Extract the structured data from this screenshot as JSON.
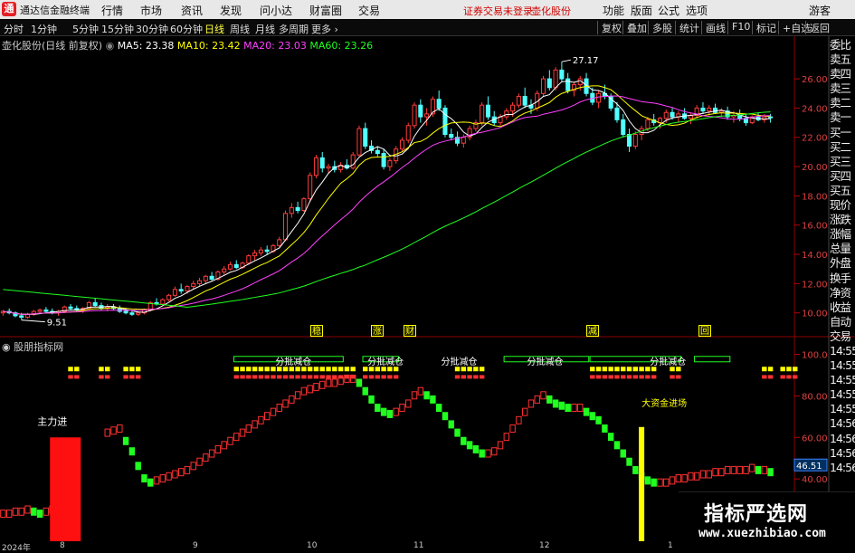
{
  "titlebar": {
    "app_name": "通达信金融终端",
    "menu": [
      "行情",
      "市场",
      "资讯",
      "发现",
      "问小达",
      "财富圈",
      "交易"
    ],
    "warning": "证券交易未登录",
    "stock": "壶化股份",
    "right_menu": [
      "功能",
      "版面",
      "公式",
      "选项"
    ],
    "guest": "游客"
  },
  "toolbar": {
    "periods": [
      "分时",
      "1分钟",
      "5分钟",
      "15分钟",
      "30分钟",
      "60分钟",
      "日线",
      "周线",
      "月线",
      "多周期",
      "更多 ›"
    ],
    "active_period": "日线",
    "right_buttons": [
      "复权",
      "叠加",
      "多股",
      "统计",
      "画线",
      "F10",
      "标记",
      "+自选",
      "返回"
    ]
  },
  "legend": {
    "name": "壶化股份(日线 前复权)",
    "ma5_label": "MA5: 23.38",
    "ma10_label": "MA10: 23.42",
    "ma20_label": "MA20: 23.03",
    "ma60_label": "MA60: 23.26"
  },
  "colors": {
    "ma5": "#ffffff",
    "ma10": "#ffff00",
    "ma20": "#ff40ff",
    "ma60": "#20ff20",
    "up": "#ff3c3c",
    "down": "#50ffff"
  },
  "price_axis": [
    "26.00",
    "24.00",
    "22.00",
    "20.00",
    "18.00",
    "16.00",
    "14.00",
    "12.00",
    "10.00"
  ],
  "indicator": {
    "title": "股朋指标网",
    "axis": [
      "100.0",
      "80.00",
      "60.00",
      "40.00"
    ],
    "current_value": "46.51",
    "label_main": "主力进",
    "label_big": "大资金进场",
    "label_reduce": "分批减仓"
  },
  "annotations": {
    "high": "27.17",
    "low": "9.51"
  },
  "price_tags": [
    "稳",
    "涨",
    "财",
    "减",
    "回"
  ],
  "side_panel": [
    "委比",
    "卖五",
    "卖四",
    "卖三",
    "卖二",
    "卖一",
    "买一",
    "买二",
    "买三",
    "买四",
    "买五",
    "现价",
    "涨跌",
    "涨幅",
    "总量",
    "外盘",
    "换手",
    "净资",
    "收益",
    "自动",
    "交易",
    "14:55",
    "14:55",
    "14:55",
    "14:55",
    "14:55",
    "14:56",
    "14:56",
    "14:56",
    "14:56"
  ],
  "time_axis": [
    "2024年",
    "8",
    "9",
    "10",
    "11",
    "12",
    "1"
  ],
  "watermark": {
    "brand": "指标严选网",
    "url": "www.xuezhibiao.com"
  },
  "chart_data": {
    "type": "candlestick",
    "y_range": [
      9.3,
      27.8
    ],
    "x_count": 126,
    "ohlc": [
      [
        10.0,
        10.2,
        9.8,
        10.1
      ],
      [
        10.1,
        10.3,
        9.9,
        10.0
      ],
      [
        10.0,
        10.1,
        9.7,
        9.8
      ],
      [
        9.8,
        10.0,
        9.51,
        9.7
      ],
      [
        9.7,
        10.0,
        9.6,
        9.9
      ],
      [
        9.9,
        10.2,
        9.8,
        10.1
      ],
      [
        10.1,
        10.3,
        10.0,
        10.2
      ],
      [
        10.2,
        10.4,
        10.0,
        10.1
      ],
      [
        10.1,
        10.3,
        9.9,
        10.0
      ],
      [
        10.0,
        10.2,
        9.8,
        10.1
      ],
      [
        10.1,
        10.5,
        10.0,
        10.4
      ],
      [
        10.4,
        10.6,
        10.2,
        10.3
      ],
      [
        10.3,
        10.5,
        10.1,
        10.2
      ],
      [
        10.2,
        10.4,
        10.0,
        10.3
      ],
      [
        10.3,
        10.8,
        10.2,
        10.7
      ],
      [
        10.7,
        11.0,
        10.4,
        10.5
      ],
      [
        10.5,
        10.7,
        10.2,
        10.3
      ],
      [
        10.3,
        10.6,
        10.1,
        10.4
      ],
      [
        10.4,
        10.6,
        10.2,
        10.3
      ],
      [
        10.3,
        10.5,
        10.0,
        10.1
      ],
      [
        10.1,
        10.3,
        9.9,
        10.0
      ],
      [
        10.0,
        10.2,
        9.8,
        9.9
      ],
      [
        9.9,
        10.1,
        9.8,
        10.0
      ],
      [
        10.0,
        10.3,
        9.9,
        10.2
      ],
      [
        10.2,
        10.8,
        10.1,
        10.7
      ],
      [
        10.7,
        11.0,
        10.5,
        10.6
      ],
      [
        10.6,
        11.0,
        10.5,
        10.9
      ],
      [
        10.9,
        11.3,
        10.8,
        11.2
      ],
      [
        11.2,
        11.8,
        11.1,
        11.6
      ],
      [
        11.6,
        12.0,
        11.3,
        11.5
      ],
      [
        11.5,
        11.9,
        11.3,
        11.8
      ],
      [
        11.8,
        12.2,
        11.6,
        12.0
      ],
      [
        12.0,
        12.4,
        11.8,
        12.2
      ],
      [
        12.2,
        12.6,
        12.0,
        12.5
      ],
      [
        12.5,
        12.8,
        12.2,
        12.3
      ],
      [
        12.3,
        12.9,
        12.2,
        12.8
      ],
      [
        12.8,
        13.2,
        12.6,
        13.0
      ],
      [
        13.0,
        13.5,
        12.9,
        13.3
      ],
      [
        13.3,
        13.6,
        13.0,
        13.1
      ],
      [
        13.1,
        13.5,
        13.0,
        13.4
      ],
      [
        13.4,
        14.0,
        13.3,
        13.9
      ],
      [
        13.9,
        14.3,
        13.6,
        14.1
      ],
      [
        14.1,
        14.5,
        13.9,
        14.3
      ],
      [
        14.3,
        14.6,
        14.0,
        14.2
      ],
      [
        14.2,
        14.7,
        14.1,
        14.6
      ],
      [
        14.6,
        15.2,
        14.5,
        15.0
      ],
      [
        15.0,
        17.0,
        14.9,
        16.8
      ],
      [
        16.8,
        17.5,
        16.5,
        17.2
      ],
      [
        17.2,
        17.6,
        16.8,
        17.0
      ],
      [
        17.0,
        17.9,
        16.9,
        17.8
      ],
      [
        17.8,
        19.6,
        17.6,
        19.4
      ],
      [
        19.4,
        20.8,
        19.2,
        20.6
      ],
      [
        20.6,
        21.0,
        19.6,
        19.9
      ],
      [
        19.9,
        20.2,
        19.5,
        20.0
      ],
      [
        20.0,
        20.4,
        19.6,
        19.8
      ],
      [
        19.8,
        20.3,
        19.6,
        20.1
      ],
      [
        20.1,
        20.5,
        19.8,
        19.9
      ],
      [
        19.9,
        21.0,
        19.8,
        20.8
      ],
      [
        20.8,
        22.8,
        20.7,
        22.6
      ],
      [
        22.6,
        23.0,
        21.2,
        21.4
      ],
      [
        21.4,
        21.8,
        20.9,
        21.1
      ],
      [
        21.1,
        21.4,
        20.7,
        20.9
      ],
      [
        20.9,
        21.2,
        19.8,
        20.0
      ],
      [
        20.0,
        20.6,
        19.7,
        20.4
      ],
      [
        20.4,
        21.4,
        20.2,
        21.2
      ],
      [
        21.2,
        22.0,
        21.0,
        21.8
      ],
      [
        21.8,
        23.0,
        21.6,
        22.8
      ],
      [
        22.8,
        24.4,
        22.6,
        24.2
      ],
      [
        24.2,
        24.6,
        23.0,
        23.4
      ],
      [
        23.4,
        24.0,
        22.8,
        23.6
      ],
      [
        23.6,
        24.8,
        23.4,
        24.6
      ],
      [
        24.6,
        25.2,
        23.8,
        24.0
      ],
      [
        24.0,
        24.2,
        22.0,
        22.2
      ],
      [
        22.2,
        22.6,
        21.8,
        22.0
      ],
      [
        22.0,
        22.4,
        21.4,
        21.6
      ],
      [
        21.6,
        22.2,
        21.3,
        22.0
      ],
      [
        22.0,
        22.8,
        21.8,
        22.6
      ],
      [
        22.6,
        23.2,
        22.4,
        23.0
      ],
      [
        23.0,
        24.4,
        22.8,
        24.2
      ],
      [
        24.2,
        24.8,
        23.2,
        23.4
      ],
      [
        23.4,
        23.8,
        22.8,
        23.0
      ],
      [
        23.0,
        23.6,
        22.8,
        23.4
      ],
      [
        23.4,
        24.0,
        23.2,
        23.8
      ],
      [
        23.8,
        24.4,
        23.4,
        24.2
      ],
      [
        24.2,
        25.0,
        24.0,
        24.8
      ],
      [
        24.8,
        25.4,
        24.0,
        24.2
      ],
      [
        24.2,
        24.6,
        23.6,
        24.0
      ],
      [
        24.0,
        25.2,
        23.8,
        25.0
      ],
      [
        25.0,
        26.2,
        24.8,
        26.0
      ],
      [
        26.0,
        26.6,
        25.2,
        25.4
      ],
      [
        25.4,
        26.8,
        25.2,
        26.6
      ],
      [
        26.6,
        27.17,
        25.8,
        26.0
      ],
      [
        26.0,
        26.4,
        25.0,
        25.2
      ],
      [
        25.2,
        25.8,
        24.8,
        25.6
      ],
      [
        25.6,
        26.2,
        25.2,
        26.0
      ],
      [
        26.0,
        26.4,
        24.8,
        25.0
      ],
      [
        25.0,
        25.4,
        24.2,
        24.4
      ],
      [
        24.4,
        25.2,
        24.0,
        25.0
      ],
      [
        25.0,
        25.6,
        24.6,
        24.8
      ],
      [
        24.8,
        25.0,
        23.8,
        24.0
      ],
      [
        24.0,
        24.4,
        23.0,
        23.2
      ],
      [
        23.2,
        23.6,
        22.0,
        22.2
      ],
      [
        22.2,
        22.6,
        21.0,
        21.4
      ],
      [
        21.4,
        22.4,
        21.2,
        22.2
      ],
      [
        22.2,
        22.8,
        21.8,
        22.6
      ],
      [
        22.6,
        23.4,
        22.4,
        23.2
      ],
      [
        23.2,
        23.6,
        22.8,
        23.0
      ],
      [
        23.0,
        23.4,
        22.6,
        23.3
      ],
      [
        23.3,
        23.9,
        23.0,
        23.7
      ],
      [
        23.7,
        24.0,
        23.2,
        23.4
      ],
      [
        23.4,
        23.8,
        23.0,
        23.6
      ],
      [
        23.6,
        24.0,
        23.2,
        23.3
      ],
      [
        23.3,
        23.7,
        22.9,
        23.5
      ],
      [
        23.5,
        24.2,
        23.3,
        24.0
      ],
      [
        24.0,
        24.4,
        23.6,
        23.8
      ],
      [
        23.8,
        24.2,
        23.5,
        24.0
      ],
      [
        24.0,
        24.3,
        23.6,
        23.7
      ],
      [
        23.7,
        24.0,
        23.4,
        23.8
      ],
      [
        23.8,
        24.1,
        23.2,
        23.4
      ],
      [
        23.4,
        23.8,
        23.0,
        23.5
      ],
      [
        23.5,
        23.9,
        23.1,
        23.3
      ],
      [
        23.3,
        23.6,
        22.8,
        23.0
      ],
      [
        23.0,
        23.5,
        22.9,
        23.4
      ],
      [
        23.4,
        23.7,
        23.1,
        23.2
      ],
      [
        23.2,
        23.6,
        23.0,
        23.4
      ],
      [
        23.4,
        23.6,
        23.0,
        23.38
      ]
    ],
    "indicator_values": [
      25,
      25,
      26,
      26,
      27,
      26,
      25,
      26,
      27,
      26,
      48,
      52,
      55,
      56,
      58,
      60,
      62,
      64,
      65,
      66,
      60,
      55,
      48,
      42,
      40,
      41,
      42,
      43,
      44,
      45,
      46,
      48,
      50,
      52,
      54,
      56,
      58,
      60,
      62,
      64,
      66,
      68,
      70,
      72,
      74,
      76,
      78,
      80,
      82,
      84,
      85,
      86,
      87,
      88,
      88,
      89,
      90,
      90,
      88,
      84,
      80,
      76,
      74,
      73,
      74,
      76,
      78,
      82,
      84,
      82,
      80,
      76,
      72,
      68,
      64,
      60,
      58,
      56,
      54,
      54,
      55,
      58,
      62,
      66,
      70,
      74,
      78,
      80,
      82,
      80,
      78,
      77,
      76,
      76,
      76,
      74,
      72,
      70,
      66,
      62,
      58,
      54,
      50,
      46,
      43,
      41,
      40,
      40,
      40,
      41,
      42,
      42,
      43,
      43,
      44,
      44,
      45,
      45,
      46,
      46,
      46,
      46,
      47,
      46,
      46,
      45
    ]
  }
}
